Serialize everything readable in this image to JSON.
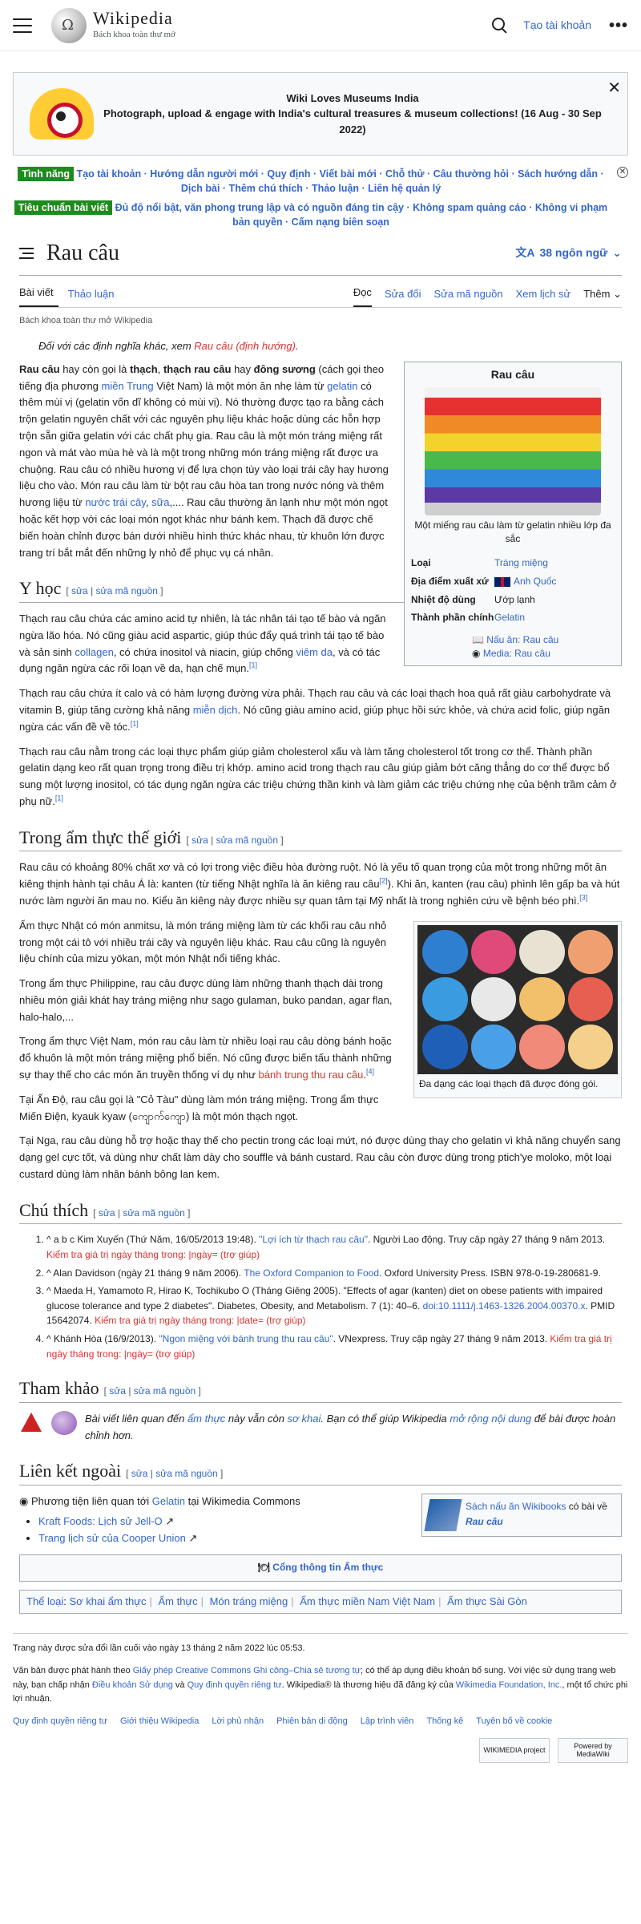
{
  "header": {
    "wordmark": "Wikipedia",
    "tagline": "Bách khoa toàn thư mở",
    "create_account": "Tạo tài khoản",
    "more": "•••"
  },
  "banner": {
    "line1": "Wiki Loves Museums India",
    "line2": "Photograph, upload & engage with India's cultural treasures & museum collections! (16 Aug - 30 Sep 2022)",
    "close": "✕"
  },
  "sitenotice": {
    "tag1": "Tình năng",
    "links1": "Tạo tài khoản · Hướng dẫn người mới · Quy định · Viết bài mới · Chỗ thử · Câu thường hỏi · Sách hướng dẫn · Dịch bài · Thêm chú thích · Thảo luận · Liên hệ quản lý",
    "tag2": "Tiêu chuẩn bài viết",
    "links2": "Đủ độ nổi bật, văn phong trung lập và có nguồn đáng tin cậy · Không spam quảng cáo · Không vi phạm bản quyền · Cấm nạng biên soạn",
    "close": "✕"
  },
  "page": {
    "title": "Rau câu",
    "languages": "38 ngôn ngữ",
    "lang_icon": "文A",
    "tabs_left": [
      "Bài viết",
      "Thảo luận"
    ],
    "tabs_right": [
      "Đọc",
      "Sửa đổi",
      "Sửa mã nguồn",
      "Xem lịch sử"
    ],
    "more": "Thêm",
    "tagline": "Bách khoa toàn thư mở Wikipedia"
  },
  "hatnote": {
    "pre": "Đối với các định nghĩa khác, xem ",
    "link": "Rau câu (định hướng)",
    "post": "."
  },
  "infobox": {
    "title": "Rau câu",
    "caption": "Một miếng rau câu làm từ gelatin nhiều lớp đa sắc",
    "rows": [
      {
        "k": "Loại",
        "v": "Tráng miệng",
        "link": true
      },
      {
        "k": "Địa điểm xuất xứ",
        "v": "Anh Quốc",
        "link": true,
        "flag": true
      },
      {
        "k": "Nhiệt độ dùng",
        "v": "Ướp lạnh",
        "link": false
      },
      {
        "k": "Thành phần chính",
        "v": "Gelatin",
        "link": true
      }
    ],
    "links": [
      "Nấu ăn: Rau câu",
      "Media: Rau câu"
    ]
  },
  "intro": {
    "p1a": "Rau câu",
    "p1b": " hay còn gọi là ",
    "p1c": "thạch",
    "p1d": ", ",
    "p1e": "thạch rau câu",
    "p1f": " hay ",
    "p1g": "đông sương",
    "p1h": " (cách gọi theo tiếng địa phương ",
    "p1i": "miền Trung",
    "p1j": " Việt Nam) là một món ăn nhẹ làm từ ",
    "p1k": "gelatin",
    "p1l": " có thêm mùi vị (gelatin vốn dĩ không có mùi vị). Nó thường được tạo ra bằng cách trộn gelatin nguyên chất với các nguyên phụ liệu khác hoặc dùng các hỗn hợp trộn sẵn giữa gelatin với các chất phụ gia. Rau câu là một món tráng miệng rất ngon và mát vào mùa hè và là một trong những món tráng miệng rất được ưa chuộng. Rau câu có nhiều hương vị để lựa chọn tùy vào loại trái cây hay hương liệu cho vào. Món rau câu làm từ bột rau câu hòa tan trong nước nóng và thêm hương liệu từ ",
    "p1m": "nước trái cây",
    "p1n": ", ",
    "p1o": "sữa",
    "p1p": ",.... Rau câu thường ăn lạnh như một món ngọt hoặc kết hợp với các loại món ngọt khác như bánh kem. Thạch đã được chế biến hoàn chỉnh được bán dưới nhiều hình thức khác nhau, từ khuôn lớn được trang trí bắt mắt đến những ly nhỏ để phục vụ cá nhân."
  },
  "yhoc": {
    "heading": "Y học",
    "edit": "sửa",
    "editsrc": "sửa mã nguồn",
    "p1a": "Thạch rau câu chứa các amino acid tự nhiên, là tác nhân tái tạo tế bào và ngăn ngừa lão hóa. Nó cũng giàu acid aspartic, giúp thúc đẩy quá trình tái tạo tế bào và sản sinh ",
    "p1b": "collagen",
    "p1c": ", có chứa inositol và niacin, giúp chống ",
    "p1d": "viêm da",
    "p1e": ", và có tác dụng ngăn ngừa các rối loạn về da, hạn chế mụn.",
    "p2a": "Thạch rau câu chứa ít calo và có hàm lượng đường vừa phải. Thạch rau câu và các loại thạch hoa quả rất giàu carbohydrate và vitamin B, giúp tăng cường khả năng ",
    "p2b": "miễn dịch",
    "p2c": ". Nó cũng giàu amino acid, giúp phục hồi sức khỏe, và chứa acid folic, giúp ngăn ngừa các vấn đề về tóc.",
    "p3": "Thạch rau câu nằm trong các loại thực phẩm giúp giảm cholesterol xấu và làm tăng cholesterol tốt trong cơ thể. Thành phần gelatin dạng keo rất quan trọng trong điều trị khớp. amino acid trong thạch rau câu giúp giảm bớt căng thẳng do cơ thể được bổ sung một lượng inositol, có tác dụng ngăn ngừa các triệu chứng thần kinh và làm giảm các triệu chứng nhẹ của bệnh trầm cảm ở phụ nữ.",
    "ref": "[1]"
  },
  "amthuc": {
    "heading": "Trong ẩm thực thế giới",
    "edit": "sửa",
    "editsrc": "sửa mã nguồn",
    "p1": "Rau câu có khoảng 80% chất xơ và có lợi trong việc điều hòa đường ruột. Nó là yếu tố quan trọng của một trong những mốt ăn kiêng thịnh hành tại châu Á là: kanten (từ tiếng Nhật nghĩa là ăn kiêng rau câu",
    "p1ref": "[2]",
    "p1b": "). Khi ăn, kanten (rau câu) phình lên gấp ba và hút nước làm người ăn mau no. Kiểu ăn kiêng này được nhiều sự quan tâm tại Mỹ nhất là trong nghiên cứu về bệnh béo phì.",
    "p1ref2": "[3]",
    "p2": "Ẩm thực Nhật có món anmitsu, là món tráng miệng làm từ các khối rau câu nhỏ trong một cái tô với nhiều trái cây và nguyên liệu khác. Rau câu cũng là nguyên liệu chính của mizu yōkan, một món Nhật nổi tiếng khác.",
    "p3": "Trong ẩm thực Philippine, rau câu được dùng làm những thanh thạch dài trong nhiều món giải khát hay tráng miệng như sago gulaman, buko pandan, agar flan, halo-halo,...",
    "p4a": "Trong ẩm thực Việt Nam, món rau câu làm từ nhiều loại rau câu dòng bánh hoặc đổ khuôn là một món tráng miệng phổ biến. Nó cũng được biến tấu thành những sự thay thế cho các món ăn truyền thống ví dụ như ",
    "p4b": "bánh trung thu rau câu",
    "p4c": ".",
    "p4ref": "[4]",
    "p5": "Tại Ấn Độ, rau câu gọi là \"Cỏ Tàu\" dùng làm món tráng miệng. Trong ẩm thực Miến Điện, kyauk kyaw (ကျောက်ကျော) là một món thạch ngọt.",
    "p6": "Tại Nga, rau câu dùng hỗ trợ hoặc thay thế cho pectin trong các loại mứt, nó được dùng thay cho gelatin vì khả năng chuyển sang dạng gel cực tốt, và dùng như chất làm dày cho souffle và bánh custard. Rau câu còn được dùng trong ptich'ye moloko, một loại custard dùng làm nhân bánh bông lan kem.",
    "thumb_caption": "Đa dạng các loại thạch đã được đóng gói."
  },
  "chuthich": {
    "heading": "Chú thích",
    "edit": "sửa",
    "editsrc": "sửa mã nguồn",
    "refs": [
      {
        "pre": "^ a b c Kim Xuyến (Thứ Năm, 16/05/2013 19:48). ",
        "link": "\"Lợi ích từ thạch rau câu\"",
        "post": ". Người Lao động. Truy cập ngày 27 tháng 9 năm 2013. ",
        "red": "Kiểm tra giá trị ngày tháng trong: |ngày= (trợ giúp)"
      },
      {
        "pre": "^ Alan Davidson (ngày 21 tháng 9 năm 2006). ",
        "link": "The Oxford Companion to Food",
        "post": ". Oxford University Press. ISBN 978-0-19-280681-9.",
        "red": ""
      },
      {
        "pre": "^ Maeda H, Yamamoto R, Hirao K, Tochikubo O (Tháng Giêng 2005). \"Effects of agar (kanten) diet on obese patients with impaired glucose tolerance and type 2 diabetes\". Diabetes, Obesity, and Metabolism. 7 (1): 40–6. ",
        "link": "doi:10.1111/j.1463-1326.2004.00370.x",
        "post": ". PMID 15642074. ",
        "red": "Kiểm tra giá trị ngày tháng trong: |date= (trợ giúp)"
      },
      {
        "pre": "^ Khánh Hòa (16/9/2013). ",
        "link": "\"Ngon miệng với bánh trung thu rau câu\"",
        "post": ". VNexpress. Truy cập ngày 27 tháng 9 năm 2013. ",
        "red": "Kiểm tra giá trị ngày tháng trong: |ngày= (trợ giúp)"
      }
    ]
  },
  "thamkhao": {
    "heading": "Tham khảo",
    "edit": "sửa",
    "editsrc": "sửa mã nguồn",
    "stub_a": "Bài viết liên quan đến ",
    "stub_b": "ẩm thực",
    "stub_c": " này vẫn còn ",
    "stub_d": "sơ khai",
    "stub_e": ". Bạn có thể giúp Wikipedia ",
    "stub_f": "mở rộng nội dung",
    "stub_g": " để bài được hoàn chỉnh hơn."
  },
  "lienket": {
    "heading": "Liên kết ngoài",
    "edit": "sửa",
    "editsrc": "sửa mã nguồn",
    "commons_pre": "Phương tiện liên quan tới ",
    "commons_link": "Gelatin",
    "commons_post": " tại Wikimedia Commons",
    "items": [
      "Kraft Foods: Lịch sử Jell-O",
      "Trang lịch sử của Cooper Union"
    ],
    "sister_pre": "Sách nấu ăn Wikibooks",
    "sister_mid": " có bài về",
    "sister_link": "Rau câu",
    "portal": "Cổng thông tin Ẩm thực"
  },
  "categories": {
    "label": "Thể loại",
    "items": [
      "Sơ khai ẩm thực",
      "Ẩm thực",
      "Món tráng miệng",
      "Ẩm thực miền Nam Việt Nam",
      "Ẩm thực Sài Gòn"
    ]
  },
  "footer": {
    "lastmod": "Trang này được sửa đổi lần cuối vào ngày 13 tháng 2 năm 2022 lúc 05:53.",
    "license_a": "Văn bản được phát hành theo ",
    "license_link": "Giấy phép Creative Commons Ghi công–Chia sẻ tương tự",
    "license_b": "; có thể áp dụng điều khoản bổ sung. Với việc sử dụng trang web này, bạn chấp nhận ",
    "terms": "Điều khoản Sử dụng",
    "license_c": " và ",
    "privacy": "Quy định quyền riêng tư",
    "license_d": ". Wikipedia® là thương hiệu đã đăng ký của ",
    "foundation": "Wikimedia Foundation, Inc.",
    "license_e": ", một tổ chức phi lợi nhuận.",
    "links": [
      "Quy định quyền riêng tư",
      "Giới thiệu Wikipedia",
      "Lời phủ nhận",
      "Phiên bản di động",
      "Lập trình viên",
      "Thống kê",
      "Tuyên bố về cookie"
    ],
    "badge1": "WIKIMEDIA project",
    "badge2": "Powered by MediaWiki"
  }
}
